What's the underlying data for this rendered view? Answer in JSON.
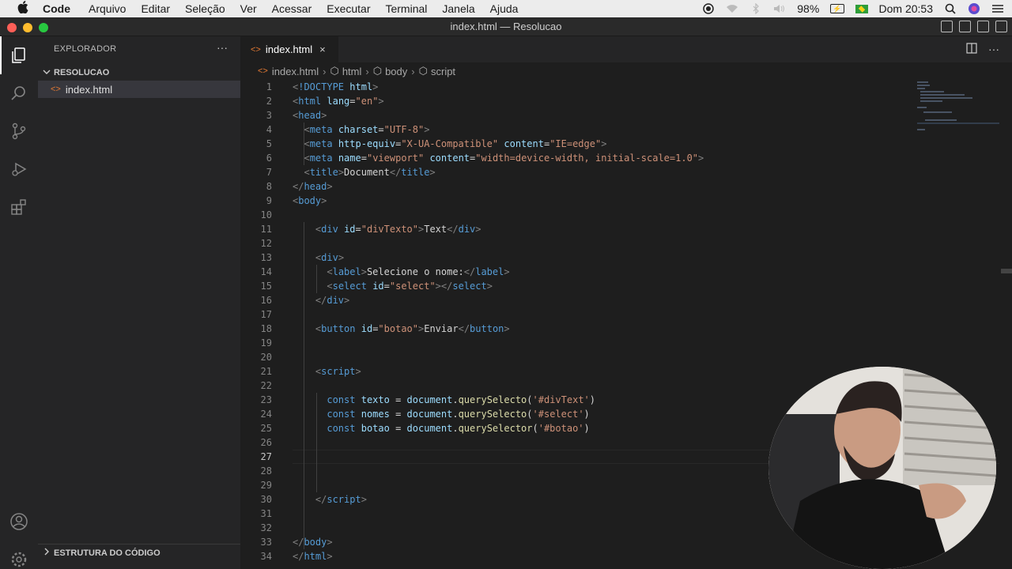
{
  "menubar": {
    "apple_icon": "apple-icon",
    "items": [
      "Code",
      "Arquivo",
      "Editar",
      "Seleção",
      "Ver",
      "Acessar",
      "Executar",
      "Terminal",
      "Janela",
      "Ajuda"
    ],
    "battery": "98%",
    "clock": "Dom 20:53"
  },
  "window": {
    "title": "index.html — Resolucao"
  },
  "sidebar": {
    "header": "EXPLORADOR",
    "more": "···",
    "folder": "RESOLUCAO",
    "file": "index.html",
    "outline": "ESTRUTURA DO CÓDIGO"
  },
  "tabs": {
    "active_label": "index.html",
    "close": "×"
  },
  "breadcrumb": {
    "file": "index.html",
    "items": [
      "html",
      "body",
      "script"
    ]
  },
  "editor": {
    "current_line": 27,
    "lines": [
      {
        "n": "1"
      },
      {
        "n": "2"
      },
      {
        "n": "3"
      },
      {
        "n": "4"
      },
      {
        "n": "5"
      },
      {
        "n": "6"
      },
      {
        "n": "7"
      },
      {
        "n": "8"
      },
      {
        "n": "9"
      },
      {
        "n": "10"
      },
      {
        "n": "11"
      },
      {
        "n": "12"
      },
      {
        "n": "13"
      },
      {
        "n": "14"
      },
      {
        "n": "15"
      },
      {
        "n": "16"
      },
      {
        "n": "17"
      },
      {
        "n": "18"
      },
      {
        "n": "19"
      },
      {
        "n": "20"
      },
      {
        "n": "21"
      },
      {
        "n": "22"
      },
      {
        "n": "23"
      },
      {
        "n": "24"
      },
      {
        "n": "25"
      },
      {
        "n": "26"
      },
      {
        "n": "27"
      },
      {
        "n": "28"
      },
      {
        "n": "29"
      },
      {
        "n": "30"
      },
      {
        "n": "31"
      },
      {
        "n": "32"
      },
      {
        "n": "33"
      },
      {
        "n": "34"
      }
    ],
    "code": {
      "l1": "!DOCTYPE",
      "l1b": "html",
      "l2_tag": "html",
      "l2_attr": "lang",
      "l2_val": "\"en\"",
      "l3_tag": "head",
      "l4_tag": "meta",
      "l4_attr": "charset",
      "l4_val": "\"UTF-8\"",
      "l5_tag": "meta",
      "l5_attr1": "http-equiv",
      "l5_val1": "\"X-UA-Compatible\"",
      "l5_attr2": "content",
      "l5_val2": "\"IE=edge\"",
      "l6_tag": "meta",
      "l6_attr1": "name",
      "l6_val1": "\"viewport\"",
      "l6_attr2": "content",
      "l6_val2": "\"width=device-width, initial-scale=1.0\"",
      "l7_tag": "title",
      "l7_text": "Document",
      "l8_tag": "head",
      "l9_tag": "body",
      "l11_tag": "div",
      "l11_attr": "id",
      "l11_val": "\"divTexto\"",
      "l11_text": "Text",
      "l13_tag": "div",
      "l14_tag": "label",
      "l14_text": "Selecione o nome:",
      "l15_tag": "select",
      "l15_attr": "id",
      "l15_val": "\"select\"",
      "l16_tag": "div",
      "l18_tag": "button",
      "l18_attr": "id",
      "l18_val": "\"botao\"",
      "l18_text": "Enviar",
      "l21_tag": "script",
      "l23_kw": "const",
      "l23_var": "texto",
      "l23_obj": "document",
      "l23_fn": "querySelecto",
      "l23_str": "'#divText'",
      "l24_kw": "const",
      "l24_var": "nomes",
      "l24_obj": "document",
      "l24_fn": "querySelecto",
      "l24_str": "'#select'",
      "l25_kw": "const",
      "l25_var": "botao",
      "l25_obj": "document",
      "l25_fn": "querySelector",
      "l25_str": "'#botao'",
      "l30_tag": "script",
      "l33_tag": "body",
      "l34_tag": "html"
    }
  },
  "colors": {
    "accent_file_icon": "#e37933",
    "tag": "#569cd6",
    "attr": "#9cdcfe",
    "string": "#ce9178",
    "function": "#dcdcaa"
  }
}
